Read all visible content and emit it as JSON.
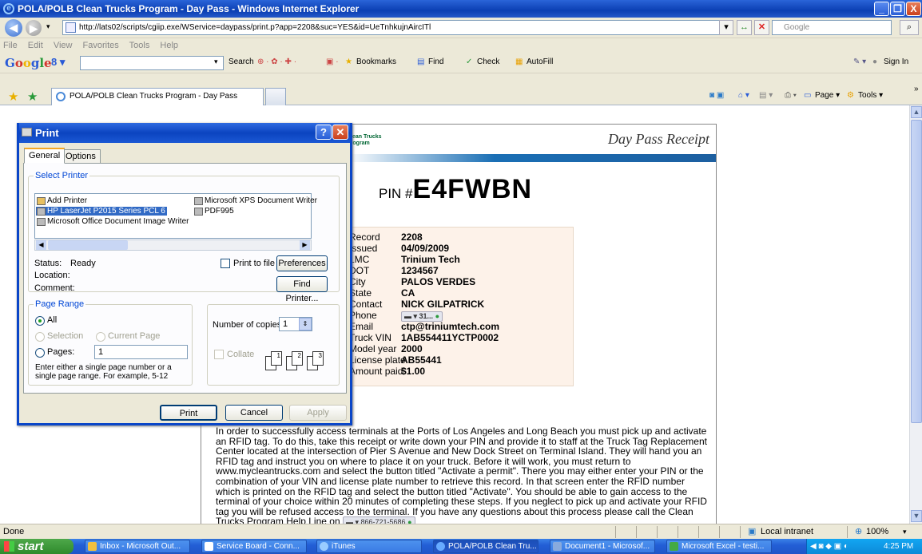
{
  "window": {
    "title": "POLA/POLB Clean Trucks Program - Day Pass - Windows Internet Explorer",
    "buttons": [
      "_",
      "❐",
      "X"
    ]
  },
  "address_bar": {
    "url": "http://lats02/scripts/cgiip.exe/WService=daypass/print.p?app=2208&suc=YES&id=UeTnhkujnAircITl",
    "search_placeholder": "Google"
  },
  "menu": [
    "File",
    "Edit",
    "View",
    "Favorites",
    "Tools",
    "Help"
  ],
  "google_toolbar": {
    "logo": "Google",
    "search_label": "Search",
    "bookmarks": "Bookmarks",
    "find": "Find",
    "check": "Check",
    "autofill": "AutoFill",
    "sign_in": "Sign In"
  },
  "tab": {
    "label": "POLA/POLB Clean Trucks Program - Day Pass"
  },
  "tab_tools": {
    "page": "Page",
    "tools": "Tools"
  },
  "receipt": {
    "brand_lines": [
      "Clean Trucks",
      "Program"
    ],
    "heading": "Day Pass Receipt",
    "pin_label": "PIN #",
    "pin": "E4FWBN",
    "fields": [
      {
        "key": "Record",
        "value": "2208"
      },
      {
        "key": "Issued",
        "value": "04/09/2009"
      },
      {
        "key": "LMC",
        "value": "Trinium Tech"
      },
      {
        "key": "DOT",
        "value": "1234567"
      },
      {
        "key": "City",
        "value": "PALOS VERDES"
      },
      {
        "key": "State",
        "value": "CA"
      },
      {
        "key": "Contact",
        "value": "NICK GILPATRICK"
      },
      {
        "key": "Phone",
        "value": "31..."
      },
      {
        "key": "Email",
        "value": "ctp@triniumtech.com"
      },
      {
        "key": "Truck VIN",
        "value": "1AB554411YCTP0002"
      },
      {
        "key": "Model year",
        "value": "2000"
      },
      {
        "key": "License plate",
        "value": "AB55441"
      },
      {
        "key": "Amount paid",
        "value": "$1.00"
      }
    ],
    "paragraph": "In order to successfully access terminals at the Ports of Los Angeles and Long Beach you must pick up and activate an RFID tag. To do this, take this receipt or write down your PIN and provide it to staff at the Truck Tag Replacement Center located at the intersection of Pier S Avenue and New Dock Street on Terminal Island. They will hand you an RFID tag and instruct you on where to place it on your truck. Before it will work, you must return to www.mycleantrucks.com and select the button titled \"Activate a permit\". There you may either enter your PIN or the combination of your VIN and license plate number to retrieve this record. In that screen enter the RFID number which is printed on the RFID tag and select the button titled \"Activate\". You should be able to gain access to the terminal of your choice within 20 minutes of completing these steps. If you neglect to pick up and activate your RFID tag you will be refused access to the terminal. If you have any questions about this process please call the Clean Trucks Program Help Line on",
    "helpline": "866-721-5686"
  },
  "print_dialog": {
    "title": "Print",
    "tabs": [
      "General",
      "Options"
    ],
    "select_printer_label": "Select Printer",
    "printers": [
      "Add Printer",
      "Microsoft XPS Document Writer",
      "HP LaserJet P2015 Series PCL 6",
      "PDF995",
      "Microsoft Office Document Image Writer"
    ],
    "status_label": "Status:",
    "status_value": "Ready",
    "location_label": "Location:",
    "comment_label": "Comment:",
    "print_to_file": "Print to file",
    "preferences": "Preferences",
    "find_printer": "Find Printer...",
    "page_range_label": "Page Range",
    "all": "All",
    "selection": "Selection",
    "current_page": "Current Page",
    "pages": "Pages:",
    "pages_value": "1",
    "page_range_hint": "Enter either a single page number or a single page range.  For example, 5-12",
    "copies_label": "Number of copies:",
    "copies_value": "1",
    "collate": "Collate",
    "print_btn": "Print",
    "cancel_btn": "Cancel",
    "apply_btn": "Apply"
  },
  "status_bar": {
    "left": "Done",
    "zone": "Local intranet",
    "zoom": "100%"
  },
  "taskbar": {
    "start": "start",
    "items": [
      "Inbox - Microsoft Out...",
      "Service Board - Conn...",
      "iTunes",
      "POLA/POLB Clean Tru...",
      "Document1 - Microsof...",
      "Microsoft Excel - testi..."
    ],
    "clock": "4:25 PM"
  }
}
